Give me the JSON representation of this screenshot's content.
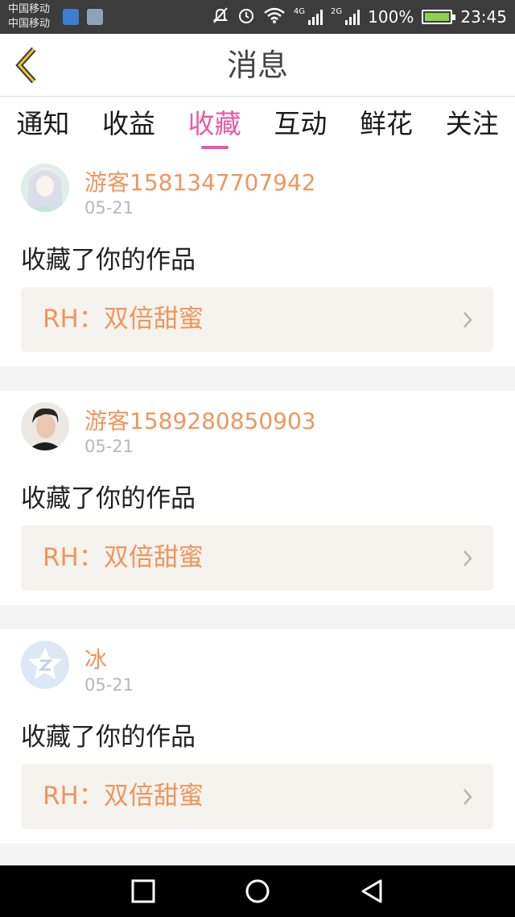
{
  "status_bar": {
    "carrier_1": "中国移动",
    "carrier_2": "中国移动",
    "net_1": "4G",
    "net_2": "2G",
    "battery": "100%",
    "time": "23:45"
  },
  "header": {
    "title": "消息"
  },
  "tabs": [
    {
      "label": "通知",
      "active": false
    },
    {
      "label": "收益",
      "active": false
    },
    {
      "label": "收藏",
      "active": true
    },
    {
      "label": "互动",
      "active": false
    },
    {
      "label": "鲜花",
      "active": false
    },
    {
      "label": "关注",
      "active": false
    }
  ],
  "messages": [
    {
      "username": "游客1581347707942",
      "date": "05-21",
      "action": "收藏了你的作品",
      "work_title": "RH：双倍甜蜜",
      "avatar": "anime-girl-avatar"
    },
    {
      "username": "游客1589280850903",
      "date": "05-21",
      "action": "收藏了你的作品",
      "work_title": "RH：双倍甜蜜",
      "avatar": "young-man-photo-avatar"
    },
    {
      "username": "冰",
      "date": "05-21",
      "action": "收藏了你的作品",
      "work_title": "RH：双倍甜蜜",
      "avatar": "qq-default-avatar"
    }
  ],
  "colors": {
    "accent": "#e85aa8",
    "username": "#f0955e",
    "work_bg": "#f5f3ee"
  }
}
